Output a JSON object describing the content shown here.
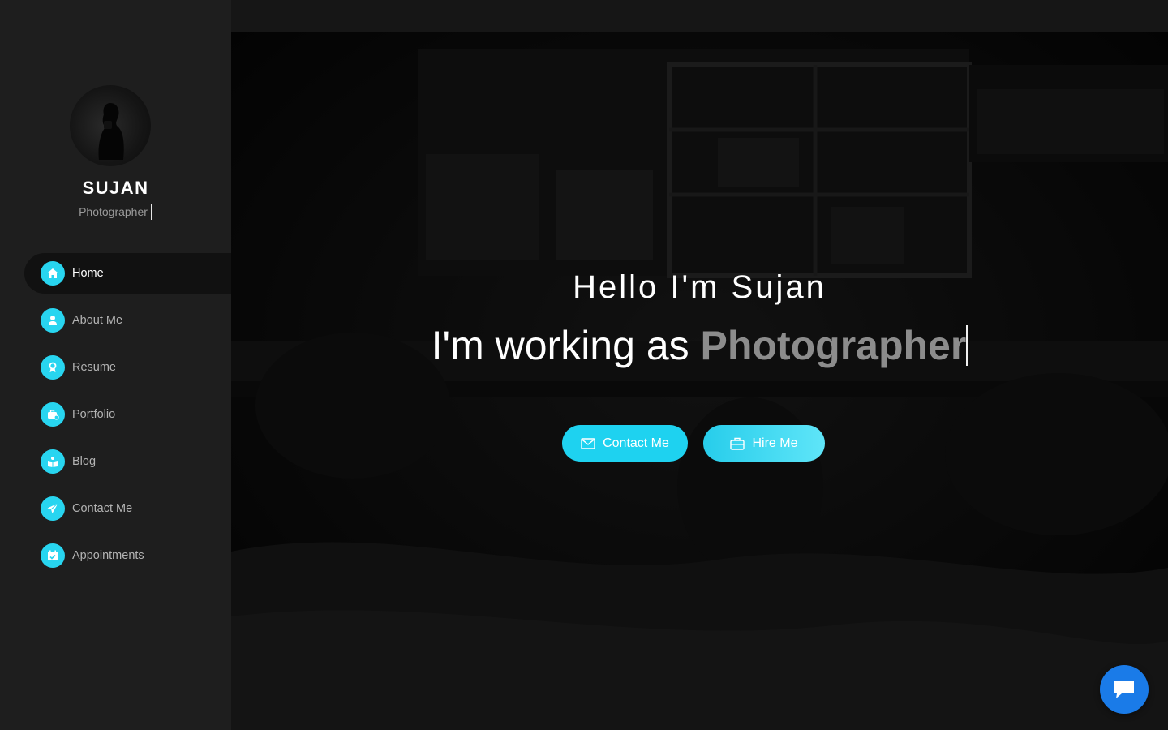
{
  "profile": {
    "name": "SUJAN",
    "role": "Photographer"
  },
  "nav": {
    "items": [
      {
        "label": "Home",
        "icon": "home-icon",
        "active": true
      },
      {
        "label": "About Me",
        "icon": "user-icon",
        "active": false
      },
      {
        "label": "Resume",
        "icon": "award-icon",
        "active": false
      },
      {
        "label": "Portfolio",
        "icon": "briefcase-icon",
        "active": false
      },
      {
        "label": "Blog",
        "icon": "book-icon",
        "active": false
      },
      {
        "label": "Contact Me",
        "icon": "paper-plane-icon",
        "active": false
      },
      {
        "label": "Appointments",
        "icon": "calendar-icon",
        "active": false
      }
    ]
  },
  "hero": {
    "greeting": "Hello I'm Sujan",
    "working_prefix": "I'm working as ",
    "working_role": "Photographer",
    "contact_button": "Contact Me",
    "hire_button": "Hire Me"
  },
  "colors": {
    "accent": "#28d5f0",
    "sidebar_bg": "#1e1e1e",
    "chat": "#1a7be8"
  }
}
